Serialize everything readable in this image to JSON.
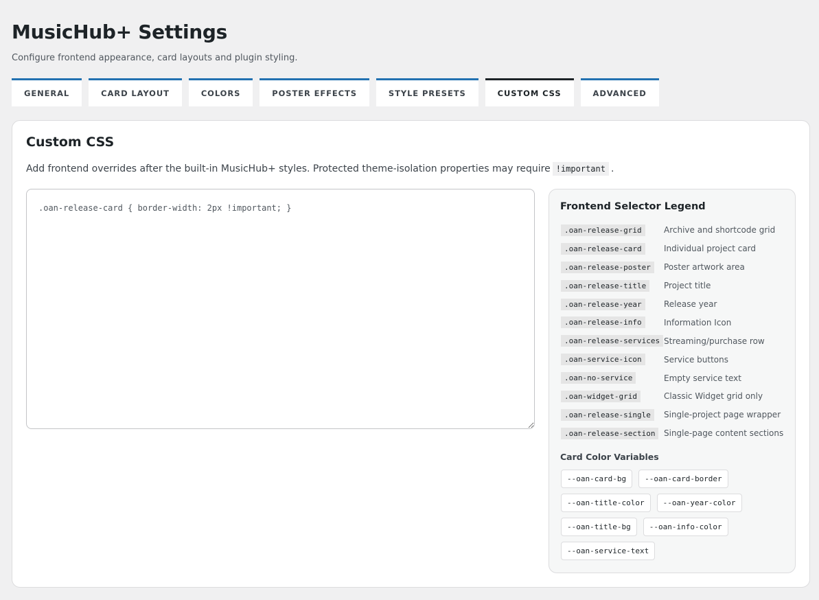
{
  "header": {
    "title": "MusicHub+ Settings",
    "subtitle": "Configure frontend appearance, card layouts and plugin styling."
  },
  "tabs": [
    {
      "label": "GENERAL",
      "active": false
    },
    {
      "label": "CARD LAYOUT",
      "active": false
    },
    {
      "label": "COLORS",
      "active": false
    },
    {
      "label": "POSTER EFFECTS",
      "active": false
    },
    {
      "label": "STYLE PRESETS",
      "active": false
    },
    {
      "label": "CUSTOM CSS",
      "active": true
    },
    {
      "label": "ADVANCED",
      "active": false
    }
  ],
  "panel": {
    "title": "Custom CSS",
    "desc_before": "Add frontend overrides after the built-in MusicHub+ styles. Protected theme-isolation properties may require",
    "desc_code": "!important",
    "desc_after": ".",
    "editor_value": ".oan-release-card { border-width: 2px !important; }"
  },
  "legend": {
    "title": "Frontend Selector Legend",
    "selectors": [
      {
        "code": ".oan-release-grid",
        "desc": "Archive and shortcode grid"
      },
      {
        "code": ".oan-release-card",
        "desc": "Individual project card"
      },
      {
        "code": ".oan-release-poster",
        "desc": "Poster artwork area"
      },
      {
        "code": ".oan-release-title",
        "desc": "Project title"
      },
      {
        "code": ".oan-release-year",
        "desc": "Release year"
      },
      {
        "code": ".oan-release-info",
        "desc": "Information Icon"
      },
      {
        "code": ".oan-release-services",
        "desc": "Streaming/purchase row"
      },
      {
        "code": ".oan-service-icon",
        "desc": "Service buttons"
      },
      {
        "code": ".oan-no-service",
        "desc": "Empty service text"
      },
      {
        "code": ".oan-widget-grid",
        "desc": "Classic Widget grid only"
      },
      {
        "code": ".oan-release-single",
        "desc": "Single-project page wrapper"
      },
      {
        "code": ".oan-release-section",
        "desc": "Single-page content sections"
      }
    ],
    "vars_title": "Card Color Variables",
    "vars": [
      "--oan-card-bg",
      "--oan-card-border",
      "--oan-title-color",
      "--oan-year-color",
      "--oan-title-bg",
      "--oan-info-color",
      "--oan-service-text"
    ]
  },
  "colors": {
    "accent": "#2271b1",
    "active_tab_border": "#1d2327",
    "page_bg": "#f0f0f1"
  }
}
